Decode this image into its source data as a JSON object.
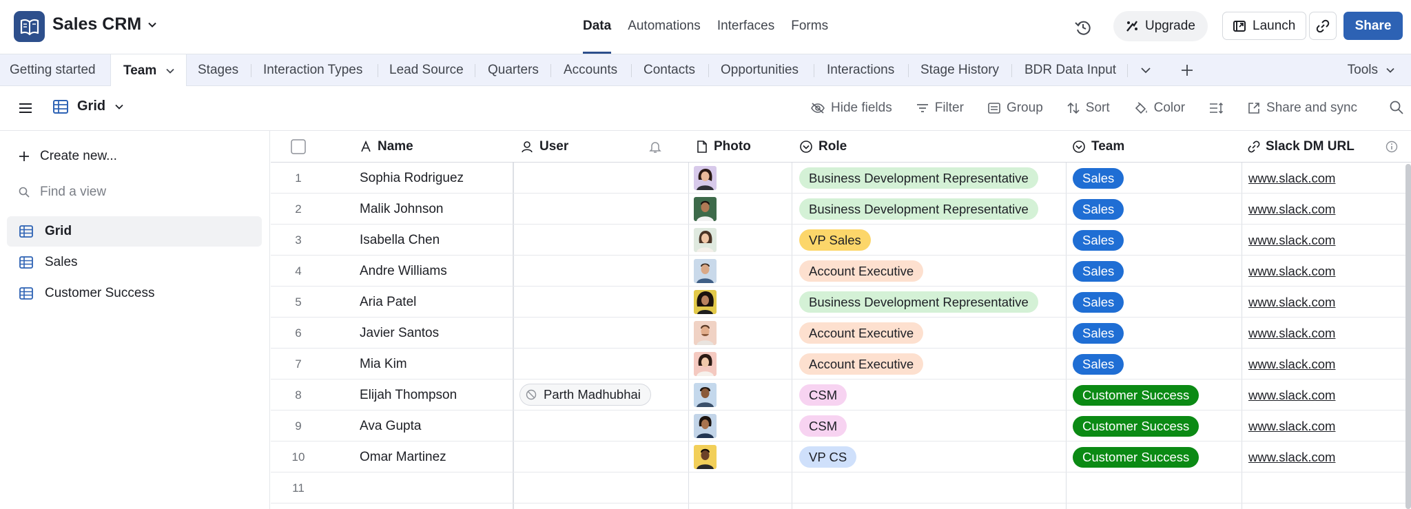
{
  "app": {
    "base_name": "Sales CRM",
    "nav": [
      "Data",
      "Automations",
      "Interfaces",
      "Forms"
    ],
    "nav_active": "Data",
    "upgrade_label": "Upgrade",
    "launch_label": "Launch",
    "share_label": "Share"
  },
  "tables": {
    "tabs": [
      "Getting started",
      "Team",
      "Stages",
      "Interaction Types",
      "Lead Source",
      "Quarters",
      "Accounts",
      "Contacts",
      "Opportunities",
      "Interactions",
      "Stage History",
      "BDR Data Input"
    ],
    "active": "Team",
    "tools_label": "Tools"
  },
  "viewbar": {
    "view_name": "Grid",
    "tools": [
      "Hide fields",
      "Filter",
      "Group",
      "Sort",
      "Color",
      "Share and sync"
    ]
  },
  "sidebar": {
    "create_label": "Create new...",
    "find_placeholder": "Find a view",
    "views": [
      "Grid",
      "Sales",
      "Customer Success"
    ],
    "active_view": "Grid"
  },
  "grid": {
    "columns": [
      "Name",
      "User",
      "Photo",
      "Role",
      "Team",
      "Slack DM URL"
    ],
    "rows": [
      {
        "num": "1",
        "name": "Sophia Rodriguez",
        "user": "",
        "role": "Business Development Representative",
        "team": "Sales",
        "url": "www.slack.com"
      },
      {
        "num": "2",
        "name": "Malik Johnson",
        "user": "",
        "role": "Business Development Representative",
        "team": "Sales",
        "url": "www.slack.com"
      },
      {
        "num": "3",
        "name": "Isabella Chen",
        "user": "",
        "role": "VP Sales",
        "team": "Sales",
        "url": "www.slack.com"
      },
      {
        "num": "4",
        "name": "Andre Williams",
        "user": "",
        "role": "Account Executive",
        "team": "Sales",
        "url": "www.slack.com"
      },
      {
        "num": "5",
        "name": "Aria Patel",
        "user": "",
        "role": "Business Development Representative",
        "team": "Sales",
        "url": "www.slack.com"
      },
      {
        "num": "6",
        "name": "Javier Santos",
        "user": "",
        "role": "Account Executive",
        "team": "Sales",
        "url": "www.slack.com"
      },
      {
        "num": "7",
        "name": "Mia Kim",
        "user": "",
        "role": "Account Executive",
        "team": "Sales",
        "url": "www.slack.com"
      },
      {
        "num": "8",
        "name": "Elijah Thompson",
        "user": "Parth Madhubhai",
        "role": "CSM",
        "team": "Customer Success",
        "url": "www.slack.com"
      },
      {
        "num": "9",
        "name": "Ava Gupta",
        "user": "",
        "role": "CSM",
        "team": "Customer Success",
        "url": "www.slack.com"
      },
      {
        "num": "10",
        "name": "Omar Martinez",
        "user": "",
        "role": "VP CS",
        "team": "Customer Success",
        "url": "www.slack.com"
      },
      {
        "num": "11",
        "name": "",
        "user": "",
        "role": "",
        "team": "",
        "url": ""
      }
    ]
  },
  "colors": {
    "brand": "#2d4f8c",
    "share": "#2d62b4",
    "team_sales": "#1f6ed4",
    "team_cs": "#0b8a14",
    "role_bdr": "#d4f1d6",
    "role_vp_sales": "#fcd66a",
    "role_ae": "#fde0cf",
    "role_csm": "#f7d3f1",
    "role_vp_cs": "#cfe0fb"
  },
  "icons": [
    "book-icon",
    "chevron-down-icon",
    "history-icon",
    "upgrade-icon",
    "launch-icon",
    "link-icon",
    "plus-icon",
    "hamburger-icon",
    "grid-icon",
    "eye-slash-icon",
    "filter-icon",
    "group-icon",
    "sort-icon",
    "color-icon",
    "row-height-icon",
    "share-sync-icon",
    "search-icon",
    "checkbox-icon",
    "text-field-icon",
    "user-field-icon",
    "bell-icon",
    "file-icon",
    "single-select-icon",
    "url-icon",
    "info-icon",
    "blocked-icon",
    "avatar"
  ]
}
